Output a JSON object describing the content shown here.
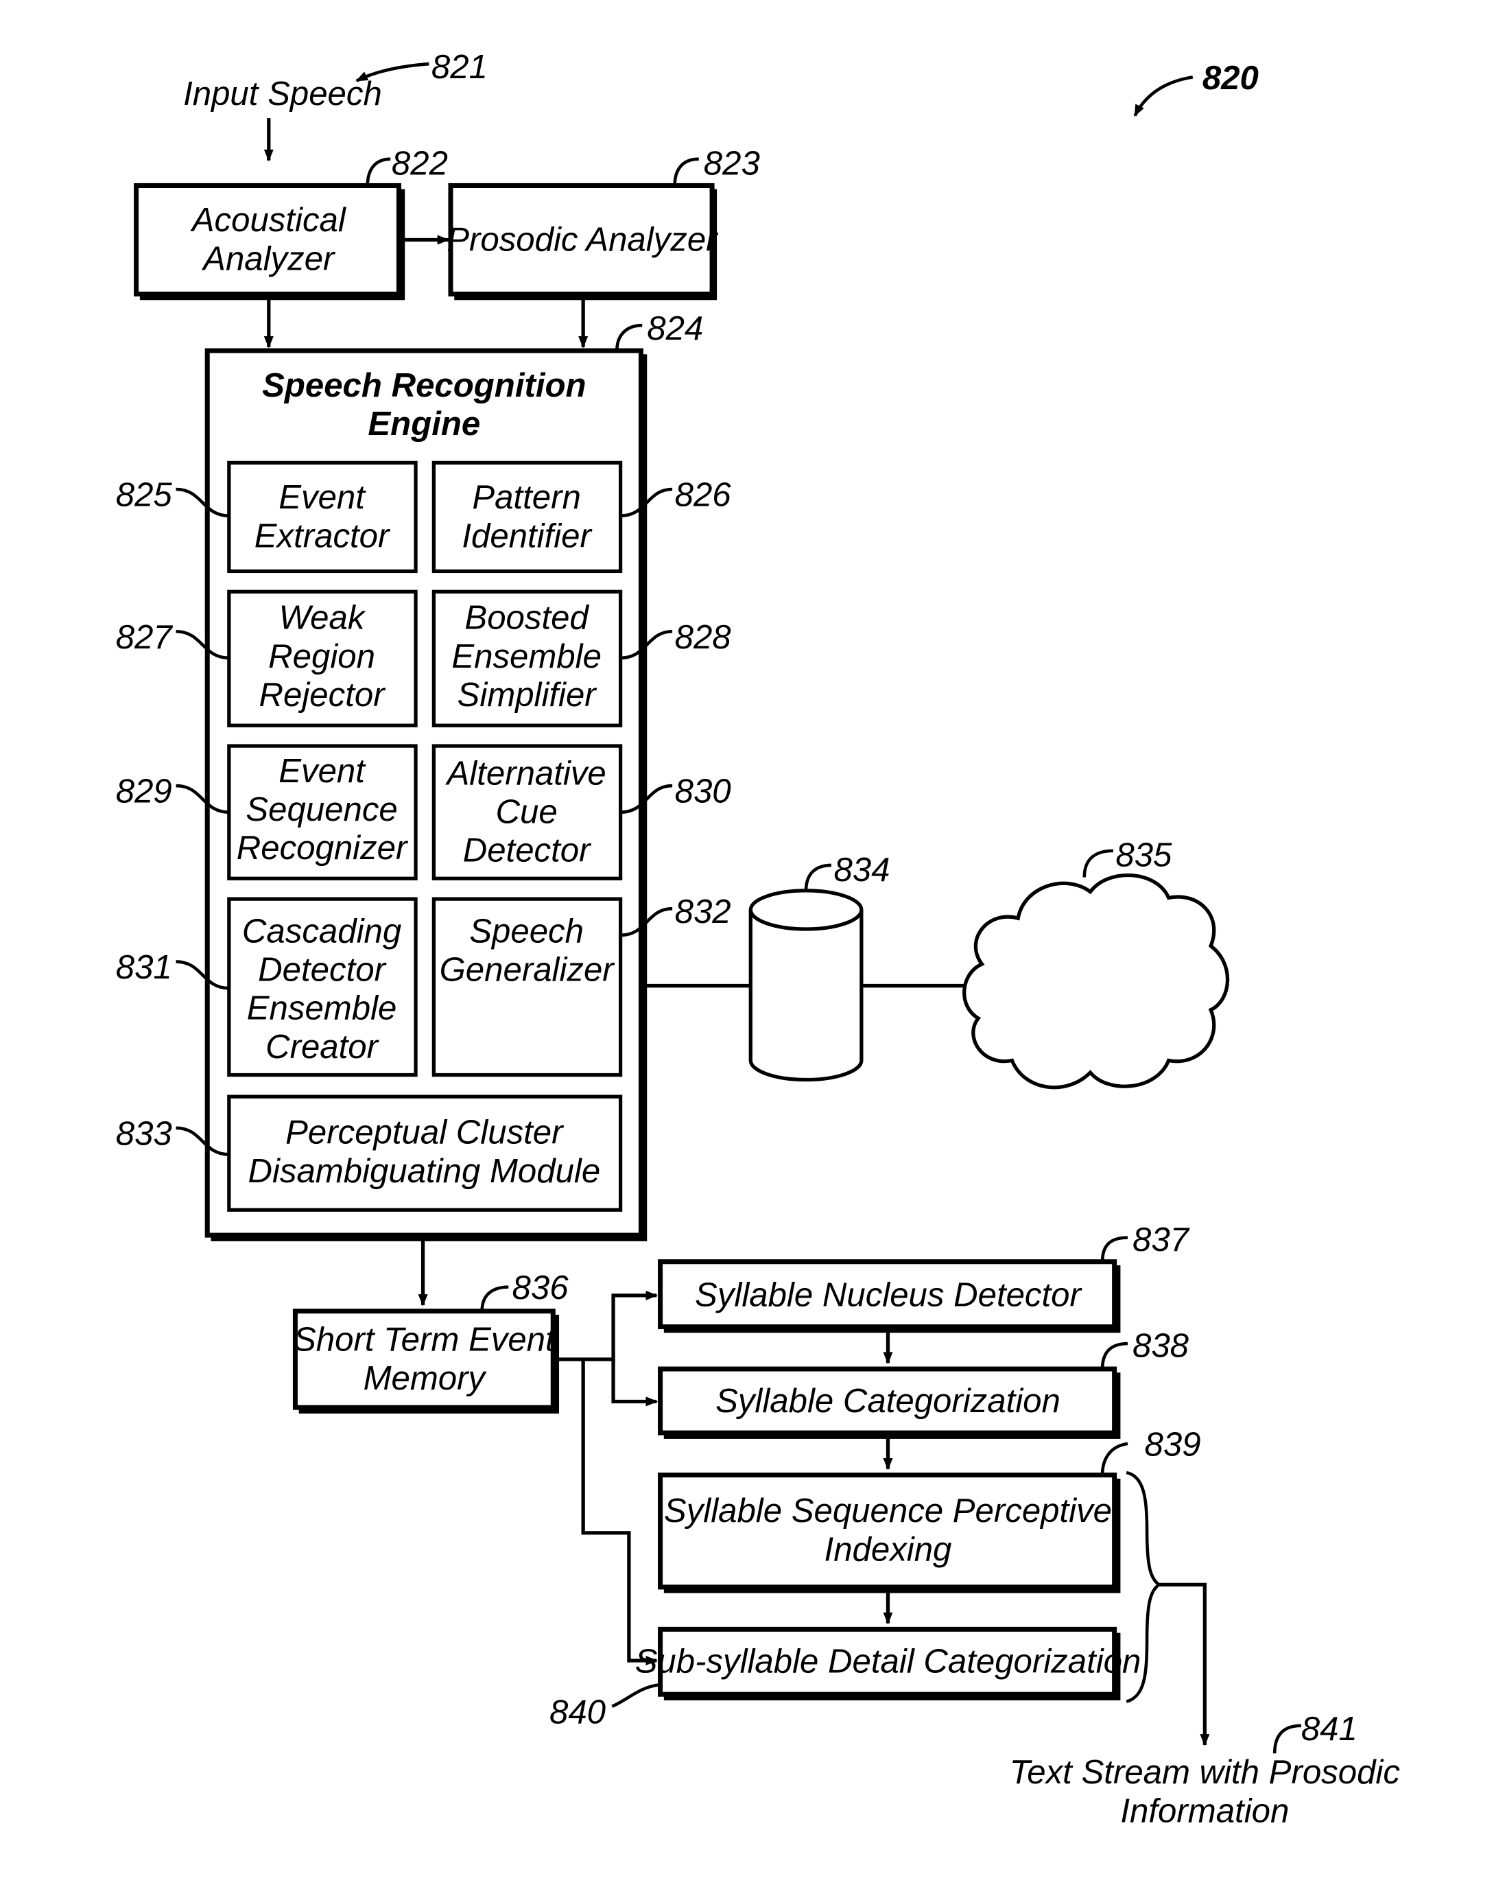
{
  "figure": {
    "reference": "820",
    "input": {
      "label": "Input Speech",
      "ref": "821"
    },
    "output": {
      "label_line1": "Text Stream with Prosodic",
      "label_line2": "Information",
      "ref": "841"
    },
    "boxes": {
      "acoustical": {
        "lines": [
          "Acoustical",
          "Analyzer"
        ],
        "ref": "822"
      },
      "prosodic": {
        "lines": [
          "Prosodic Analyzer"
        ],
        "ref": "823"
      },
      "engine": {
        "lines": [
          "Speech Recognition",
          "Engine"
        ],
        "ref": "824"
      },
      "event_extractor": {
        "lines": [
          "Event",
          "Extractor"
        ],
        "ref": "825"
      },
      "pattern_identifier": {
        "lines": [
          "Pattern",
          "Identifier"
        ],
        "ref": "826"
      },
      "weak_region": {
        "lines": [
          "Weak",
          "Region",
          "Rejector"
        ],
        "ref": "827"
      },
      "boosted_ensemble": {
        "lines": [
          "Boosted",
          "Ensemble",
          "Simplifier"
        ],
        "ref": "828"
      },
      "event_sequence": {
        "lines": [
          "Event",
          "Sequence",
          "Recognizer"
        ],
        "ref": "829"
      },
      "alt_cue": {
        "lines": [
          "Alternative",
          "Cue",
          "Detector"
        ],
        "ref": "830"
      },
      "cascading": {
        "lines": [
          "Cascading",
          "Detector",
          "Ensemble",
          "Creator"
        ],
        "ref": "831"
      },
      "speech_generalizer": {
        "lines": [
          "Speech",
          "Generalizer"
        ],
        "ref": "832"
      },
      "perceptual_cluster": {
        "lines": [
          "Perceptual Cluster",
          "Disambiguating Module"
        ],
        "ref": "833"
      },
      "database": {
        "ref": "834"
      },
      "cloud": {
        "ref": "835"
      },
      "short_term": {
        "lines": [
          "Short Term Event",
          "Memory"
        ],
        "ref": "836"
      },
      "syllable_nucleus": {
        "lines": [
          "Syllable Nucleus Detector"
        ],
        "ref": "837"
      },
      "syllable_cat": {
        "lines": [
          "Syllable Categorization"
        ],
        "ref": "838"
      },
      "syllable_seq": {
        "lines": [
          "Syllable Sequence Perceptive",
          "Indexing"
        ],
        "ref": "839"
      },
      "sub_syllable": {
        "lines": [
          "Sub-syllable Detail Categorization"
        ],
        "ref": "840"
      }
    }
  }
}
